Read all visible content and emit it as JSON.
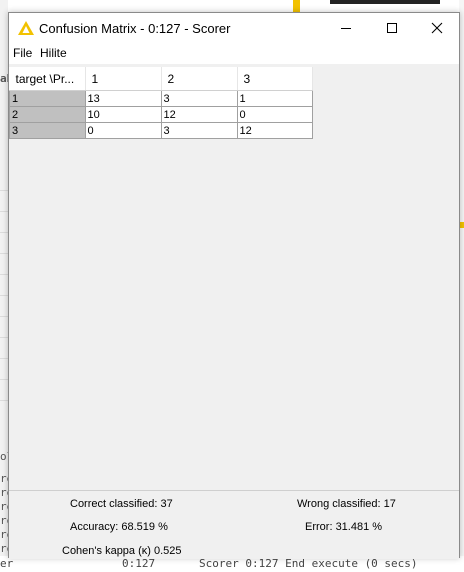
{
  "window": {
    "title": "Confusion Matrix - 0:127 - Scorer",
    "menu": [
      "File",
      "Hilite"
    ]
  },
  "matrix": {
    "corner_header": "target \\Pr...",
    "col_headers": [
      "1",
      "2",
      "3"
    ],
    "rows": [
      {
        "label": "1",
        "cells": [
          "13",
          "3",
          "1"
        ]
      },
      {
        "label": "2",
        "cells": [
          "10",
          "12",
          "0"
        ]
      },
      {
        "label": "3",
        "cells": [
          "0",
          "3",
          "12"
        ]
      }
    ]
  },
  "summary": {
    "correct_label": "Correct classified:",
    "correct_value": "37",
    "wrong_label": "Wrong classified:",
    "wrong_value": "17",
    "accuracy_label": "Accuracy:",
    "accuracy_value": "68.519",
    "accuracy_unit": "%",
    "error_label": "Error:",
    "error_value": "31.481",
    "error_unit": "%",
    "kappa_label": "Cohen's kappa (κ)",
    "kappa_value": "0.525"
  },
  "background": {
    "left_fragments": [
      "ab",
      "ol",
      "re",
      "re",
      "re",
      "re",
      "re",
      "re",
      "er"
    ],
    "status_node": "0:127",
    "status_message": "Scorer 0:127 End execute (0 secs)"
  },
  "colors": {
    "knime_yellow": "#f2c200",
    "row_header_gray": "#c0c0c0"
  }
}
